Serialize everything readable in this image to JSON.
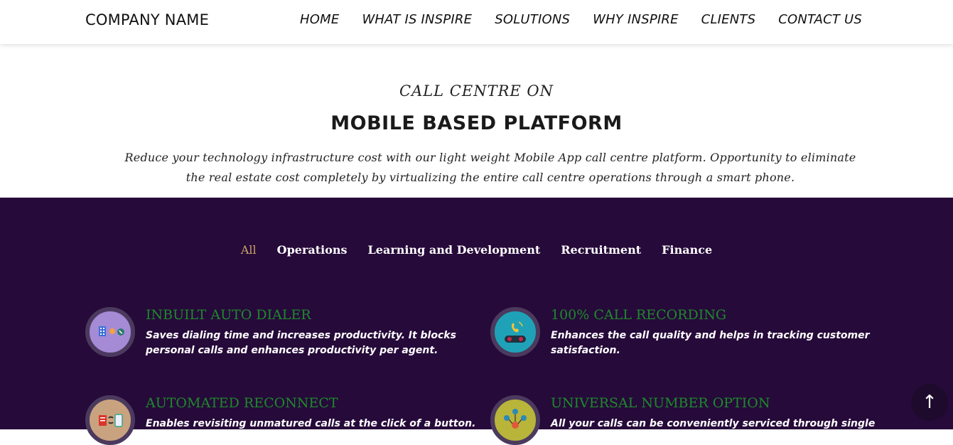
{
  "header": {
    "brand": "COMPANY NAME",
    "nav": [
      "HOME",
      "WHAT IS INSPIRE",
      "SOLUTIONS",
      "WHY INSPIRE",
      "CLIENTS",
      "CONTACT US"
    ]
  },
  "hero": {
    "pretitle": "CALL CENTRE ON",
    "title": "MOBILE BASED PLATFORM",
    "description": "Reduce your technology infrastructure cost with our light weight Mobile App call centre platform. Opportunity to eliminate the real estate cost completely by virtualizing the entire call centre operations through a smart phone."
  },
  "filters": [
    "All",
    "Operations",
    "Learning and Development",
    "Recruitment",
    "Finance"
  ],
  "features": [
    {
      "title": "INBUILT AUTO DIALER",
      "desc": "Saves dialing time and increases productivity. It blocks personal calls and enhances productivity per agent.",
      "icon": "dialer-icon"
    },
    {
      "title": "100% CALL RECORDING",
      "desc": "Enhances the call quality and helps in tracking customer satisfaction.",
      "icon": "call-recording-icon"
    },
    {
      "title": "AUTOMATED RECONNECT",
      "desc": "Enables revisiting unmatured calls at the click of a button.",
      "icon": "reconnect-icon"
    },
    {
      "title": "UNIVERSAL NUMBER OPTION",
      "desc": "All your calls can be conveniently serviced through single",
      "icon": "network-icon"
    }
  ],
  "scroll_top": "↑",
  "colors": {
    "features_bg": "#260a3a",
    "feature_title": "#1d8a2a",
    "active_filter": "#c9a56a"
  }
}
